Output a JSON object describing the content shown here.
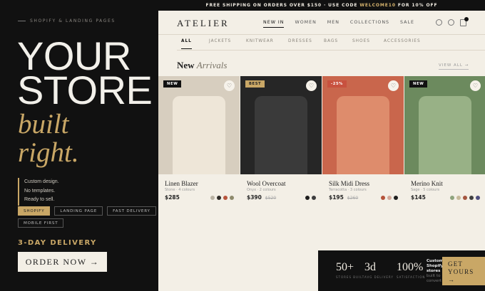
{
  "hero": {
    "kicker": "SHOPIFY & LANDING PAGES",
    "title_line1": "YOUR",
    "title_line2": "STORE",
    "accent_line1": "built",
    "accent_line2": "right.",
    "bullets": [
      "Custom design.",
      "No templates.",
      "Ready to sell."
    ],
    "tags": [
      {
        "label": "SHOPIFY",
        "highlighted": true
      },
      {
        "label": "LANDING PAGE",
        "highlighted": false
      },
      {
        "label": "FAST DELIVERY",
        "highlighted": false
      },
      {
        "label": "MOBILE FIRST",
        "highlighted": false
      }
    ],
    "delivery": "3-DAY DELIVERY",
    "order_button": "ORDER NOW →",
    "colors": {
      "background": "#111111",
      "accent": "#c9a766",
      "text": "#f2f0ea"
    }
  },
  "store": {
    "promo": {
      "text_before": "FREE SHIPPING ON ORDERS OVER $150 · USE CODE ",
      "code": "WELCOME10",
      "text_after": " FOR 10% OFF"
    },
    "brand": "ATELIER",
    "nav": [
      {
        "label": "NEW IN",
        "active": true
      },
      {
        "label": "WOMEN",
        "active": false
      },
      {
        "label": "MEN",
        "active": false
      },
      {
        "label": "COLLECTIONS",
        "active": false
      },
      {
        "label": "SALE",
        "active": false
      }
    ],
    "icons": [
      "search-icon",
      "account-icon",
      "bag-icon"
    ],
    "cart_count": "1",
    "categories": [
      {
        "label": "ALL",
        "active": true
      },
      {
        "label": "JACKETS",
        "active": false
      },
      {
        "label": "KNITWEAR",
        "active": false
      },
      {
        "label": "DRESSES",
        "active": false
      },
      {
        "label": "BAGS",
        "active": false
      },
      {
        "label": "SHOES",
        "active": false
      },
      {
        "label": "ACCESSORIES",
        "active": false
      }
    ],
    "section_title_bold": "New",
    "section_title_italic": "Arrivals",
    "view_all": "VIEW ALL →",
    "products": [
      {
        "badge": "NEW",
        "badge_type": "new",
        "name": "Linen Blazer",
        "meta": "Stone · 4 colours",
        "price": "$285",
        "old_price": "",
        "photo_bg": "#d7cebf",
        "garment": "#eee6d8",
        "swatches": [
          "#b9b2a3",
          "#2d2a26",
          "#b6543d",
          "#8e8a6c"
        ]
      },
      {
        "badge": "BEST",
        "badge_type": "best",
        "name": "Wool Overcoat",
        "meta": "Onyx · 2 colours",
        "price": "$390",
        "old_price": "$520",
        "photo_bg": "#262626",
        "garment": "#3a3a3a",
        "swatches": [
          "#1d1d1d",
          "#3d3d3d"
        ]
      },
      {
        "badge": "-25%",
        "badge_type": "sale",
        "name": "Silk Midi Dress",
        "meta": "Terracotta · 3 colours",
        "price": "$195",
        "old_price": "$260",
        "photo_bg": "#c9664c",
        "garment": "#de8c6c",
        "swatches": [
          "#b4523a",
          "#d3a99a",
          "#1d1d1d"
        ]
      },
      {
        "badge": "NEW",
        "badge_type": "new",
        "name": "Merino Knit",
        "meta": "Sage · 5 colours",
        "price": "$145",
        "old_price": "",
        "photo_bg": "#6c8a5e",
        "garment": "#98b186",
        "swatches": [
          "#8ea37d",
          "#c6b99a",
          "#a4553f",
          "#3f3f3f",
          "#4f4f7e"
        ]
      }
    ]
  },
  "cta": {
    "stats": [
      {
        "value": "50+",
        "label": "STORES BUILT"
      },
      {
        "value": "3d",
        "label": "AVG DELIVERY"
      },
      {
        "value": "100%",
        "label": "SATISFACTION"
      }
    ],
    "blurb_bold": "Custom Shopify stores",
    "blurb_rest": "built to convert",
    "button": "GET YOURS →"
  }
}
